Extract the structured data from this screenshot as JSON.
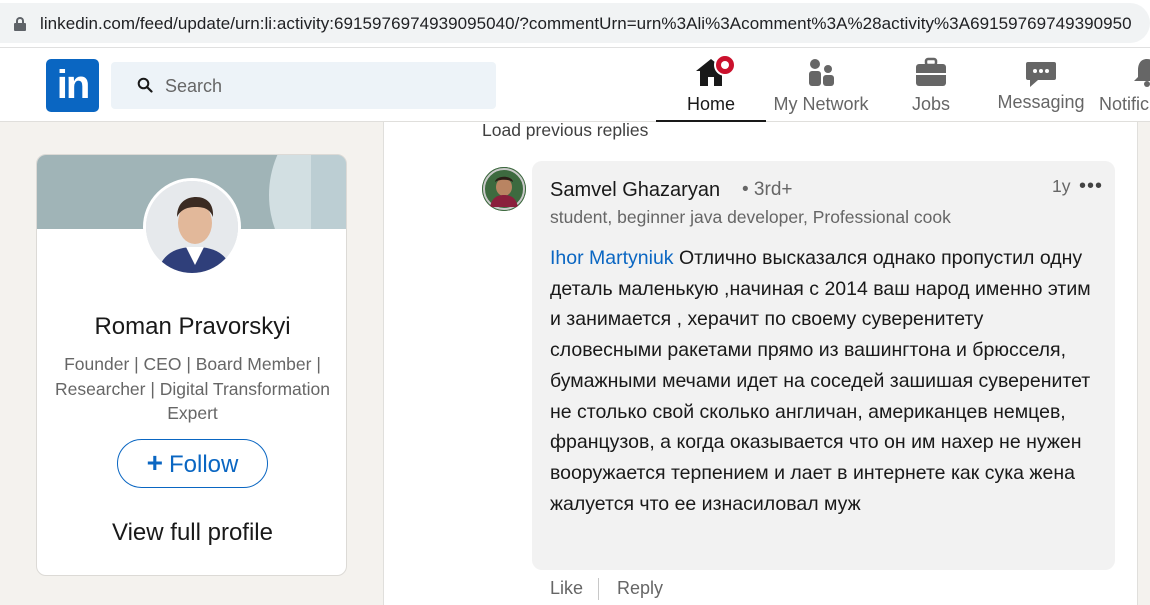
{
  "browser": {
    "url": "linkedin.com/feed/update/urn:li:activity:6915976974939095040/?commentUrn=urn%3Ali%3Acomment%3A%28activity%3A69159769749390950"
  },
  "nav": {
    "logo_text": "in",
    "search_placeholder": "Search",
    "items": [
      {
        "label": "Home",
        "icon": "home-icon",
        "active": true
      },
      {
        "label": "My Network",
        "icon": "network-icon"
      },
      {
        "label": "Jobs",
        "icon": "briefcase-icon"
      },
      {
        "label": "Messaging",
        "icon": "messaging-icon"
      },
      {
        "label": "Notific",
        "icon": "bell-icon"
      }
    ]
  },
  "profile_card": {
    "name": "Roman Pravorskyi",
    "headline": "Founder | CEO | Board Member | Researcher | Digital Transformation Expert",
    "follow_label": "Follow",
    "view_profile_label": "View full profile"
  },
  "comments": {
    "load_previous": "Load previous replies",
    "comment": {
      "author": "Samvel Ghazaryan",
      "degree": "• 3rd+",
      "time": "1y",
      "more": "•••",
      "subtitle": "student, beginner java developer, Professional cook",
      "mention": "Ihor Martyniuk",
      "text": " Отлично высказался однако пропустил одну деталь маленькую ,начиная с 2014 ваш народ именно этим и занимается , херачит по своему суверенитету словесными ракетами прямо из вашингтона и брюсселя, бумажными мечами идет на соседей зашишая суверенитет не столько свой сколько англичан, американцев немцев, французов, а когда оказывается что он им нахер не нужен вооружается терпением и лает в интернете как сука жена жалуется что ее изнасиловал муж"
    },
    "actions": {
      "like": "Like",
      "reply": "Reply"
    }
  },
  "colors": {
    "brand": "#0a66c2",
    "notification": "#cb112d",
    "bubble": "#f2f2f2"
  }
}
